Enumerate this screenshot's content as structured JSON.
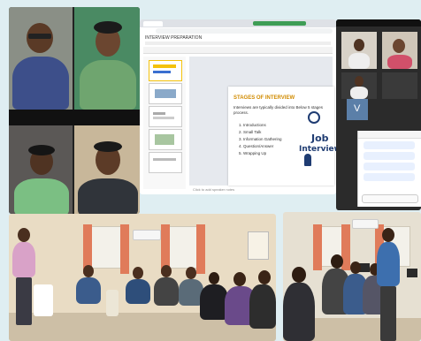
{
  "video_tiles": [
    {
      "caption": "",
      "bg": "#8a8f86",
      "skin": "#5a3a26",
      "shirt": "#3d4f8a"
    },
    {
      "caption": "",
      "bg": "#4a8a63",
      "skin": "#6b4630",
      "shirt": "#6fa56f"
    },
    {
      "caption": "",
      "bg": "#5b5856",
      "skin": "#4f3322",
      "shirt": "#7bbf83"
    },
    {
      "caption": "",
      "bg": "#c8b79a",
      "skin": "#5c3b27",
      "shirt": "#30343a"
    }
  ],
  "slides_app": {
    "doc_title": "INTERVIEW PREPARATION",
    "slide_title": "STAGES OF INTERVIEW",
    "slide_subtitle": "Interviews are typically divided into Below 5 stages process.",
    "stages": [
      "1. Introductions",
      "2. Small Talk",
      "3. Information Gathering",
      "4. Question/Answer",
      "5. Wrapping Up"
    ],
    "graphic_words": [
      "Job",
      "Interview"
    ],
    "speaker_notes_placeholder": "Click to add speaker notes",
    "accent": "#d18b00"
  },
  "participants_panel": {
    "tile_letter": "V"
  }
}
